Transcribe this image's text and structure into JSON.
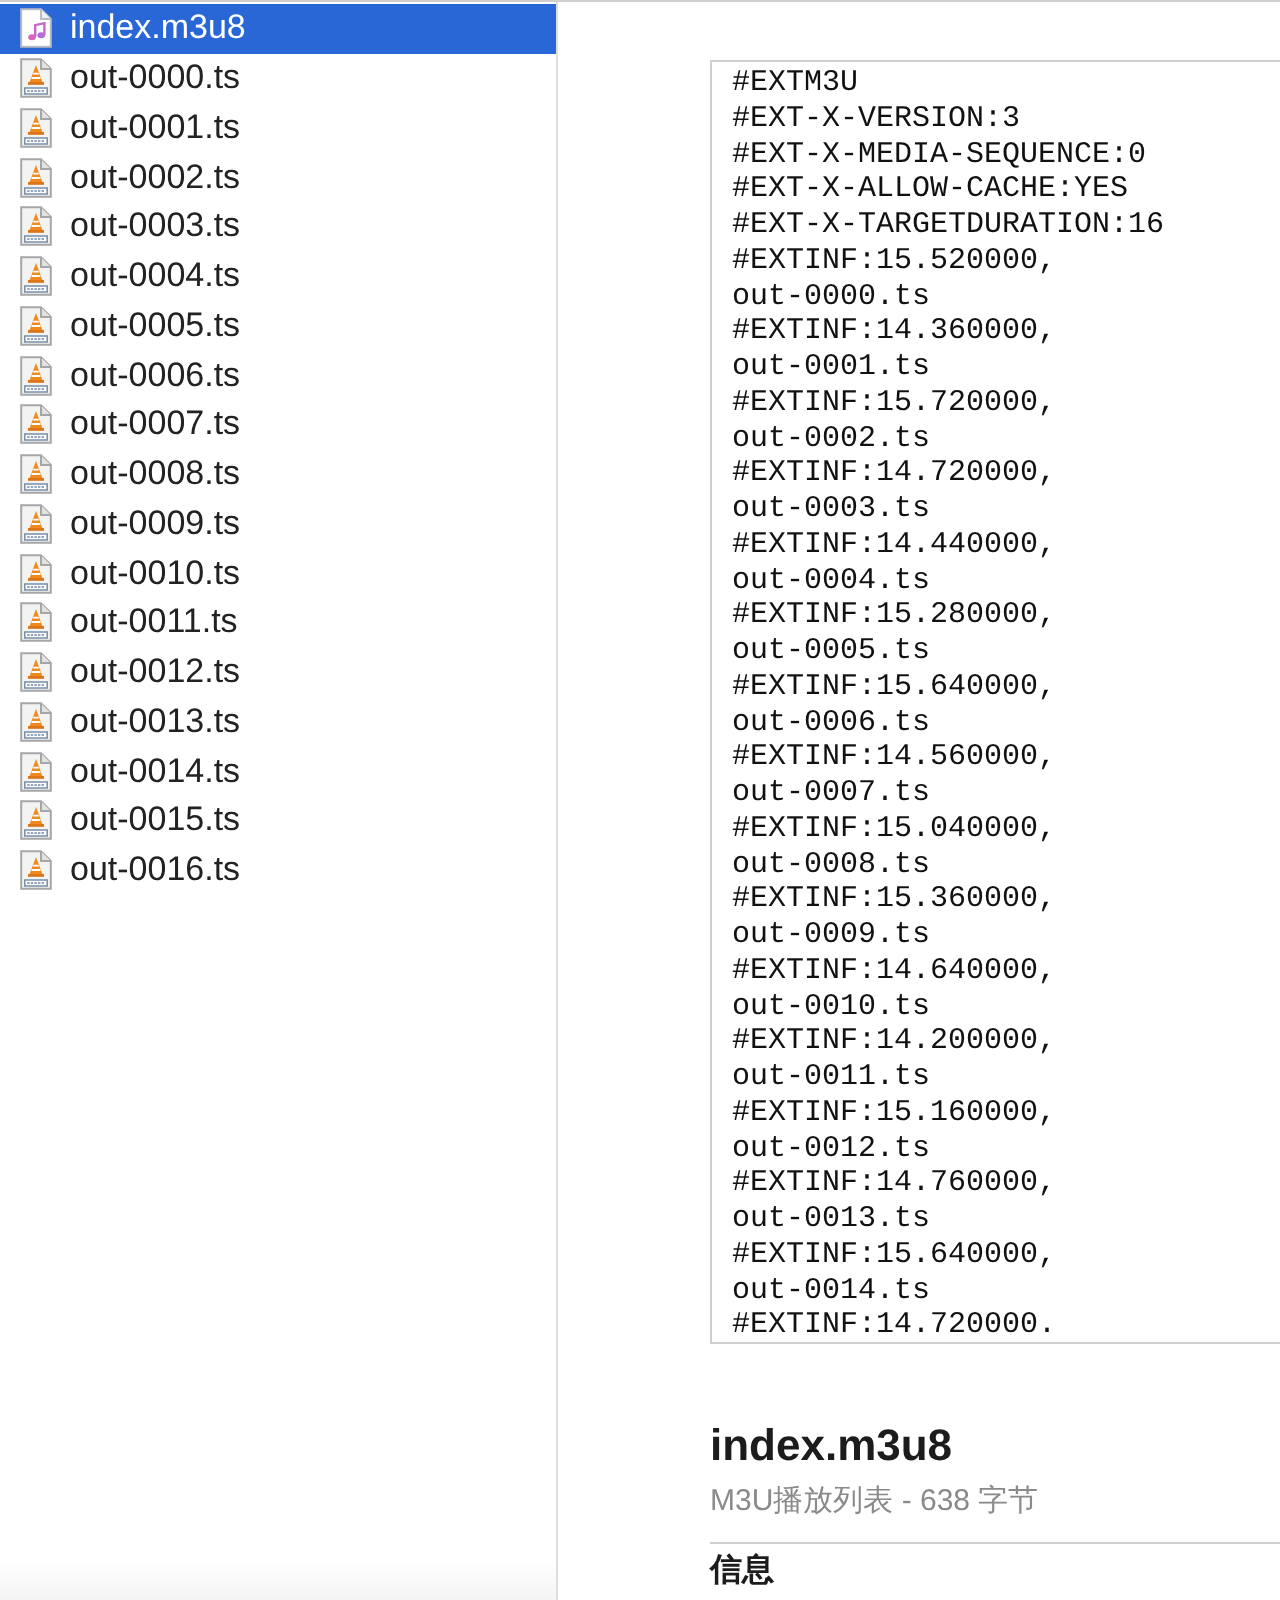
{
  "file_list": {
    "items": [
      {
        "name": "index.m3u8",
        "kind": "playlist",
        "selected": true
      },
      {
        "name": "out-0000.ts",
        "kind": "video",
        "selected": false
      },
      {
        "name": "out-0001.ts",
        "kind": "video",
        "selected": false
      },
      {
        "name": "out-0002.ts",
        "kind": "video",
        "selected": false
      },
      {
        "name": "out-0003.ts",
        "kind": "video",
        "selected": false
      },
      {
        "name": "out-0004.ts",
        "kind": "video",
        "selected": false
      },
      {
        "name": "out-0005.ts",
        "kind": "video",
        "selected": false
      },
      {
        "name": "out-0006.ts",
        "kind": "video",
        "selected": false
      },
      {
        "name": "out-0007.ts",
        "kind": "video",
        "selected": false
      },
      {
        "name": "out-0008.ts",
        "kind": "video",
        "selected": false
      },
      {
        "name": "out-0009.ts",
        "kind": "video",
        "selected": false
      },
      {
        "name": "out-0010.ts",
        "kind": "video",
        "selected": false
      },
      {
        "name": "out-0011.ts",
        "kind": "video",
        "selected": false
      },
      {
        "name": "out-0012.ts",
        "kind": "video",
        "selected": false
      },
      {
        "name": "out-0013.ts",
        "kind": "video",
        "selected": false
      },
      {
        "name": "out-0014.ts",
        "kind": "video",
        "selected": false
      },
      {
        "name": "out-0015.ts",
        "kind": "video",
        "selected": false
      },
      {
        "name": "out-0016.ts",
        "kind": "video",
        "selected": false
      }
    ]
  },
  "preview": {
    "lines": [
      "#EXTM3U",
      "#EXT-X-VERSION:3",
      "#EXT-X-MEDIA-SEQUENCE:0",
      "#EXT-X-ALLOW-CACHE:YES",
      "#EXT-X-TARGETDURATION:16",
      "#EXTINF:15.520000,",
      "out-0000.ts",
      "#EXTINF:14.360000,",
      "out-0001.ts",
      "#EXTINF:15.720000,",
      "out-0002.ts",
      "#EXTINF:14.720000,",
      "out-0003.ts",
      "#EXTINF:14.440000,",
      "out-0004.ts",
      "#EXTINF:15.280000,",
      "out-0005.ts",
      "#EXTINF:15.640000,",
      "out-0006.ts",
      "#EXTINF:14.560000,",
      "out-0007.ts",
      "#EXTINF:15.040000,",
      "out-0008.ts",
      "#EXTINF:15.360000,",
      "out-0009.ts",
      "#EXTINF:14.640000,",
      "out-0010.ts",
      "#EXTINF:14.200000,",
      "out-0011.ts",
      "#EXTINF:15.160000,",
      "out-0012.ts",
      "#EXTINF:14.760000,",
      "out-0013.ts",
      "#EXTINF:15.640000,",
      "out-0014.ts",
      "#EXTINF:14.720000."
    ]
  },
  "details": {
    "title": "index.m3u8",
    "subtitle": "M3U播放列表 - 638 字节",
    "section_heading": "信息"
  }
}
